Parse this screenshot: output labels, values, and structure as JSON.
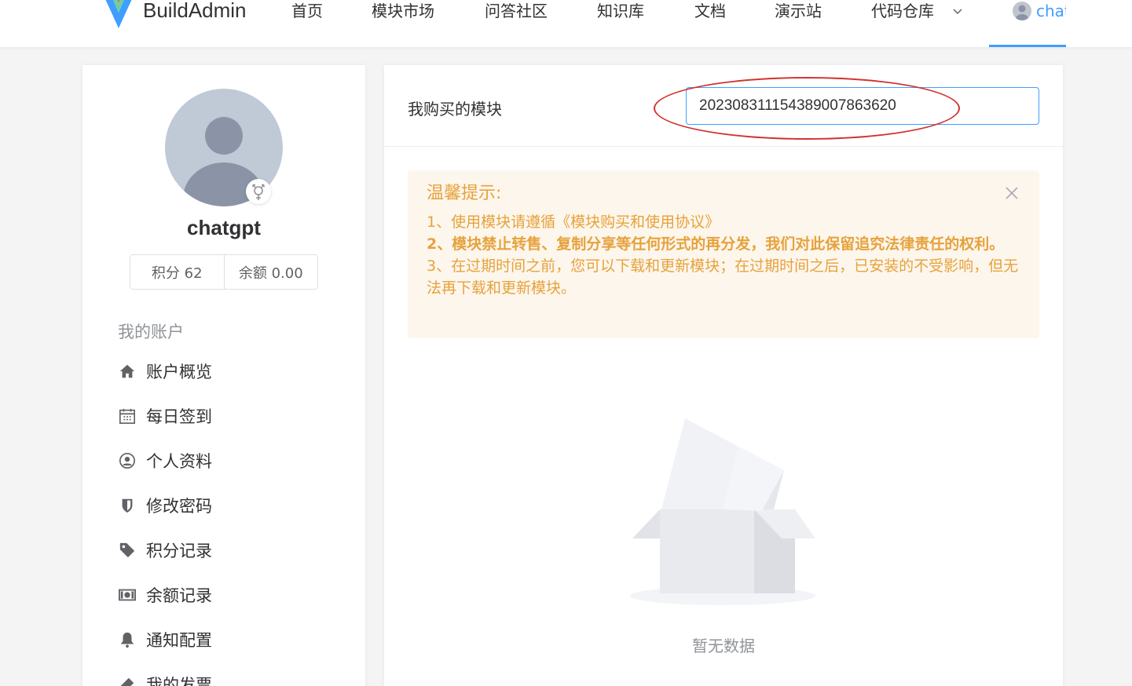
{
  "header": {
    "brand": "BuildAdmin",
    "nav": [
      {
        "label": "首页"
      },
      {
        "label": "模块市场"
      },
      {
        "label": "问答社区"
      },
      {
        "label": "知识库"
      },
      {
        "label": "文档"
      },
      {
        "label": "演示站"
      },
      {
        "label": "代码仓库"
      }
    ],
    "user_name": "chatgpt"
  },
  "sidebar": {
    "username": "chatgpt",
    "points_label": "积分 62",
    "balance_label": "余额 0.00",
    "section_title": "我的账户",
    "menu": [
      {
        "label": "账户概览",
        "icon": "home-icon"
      },
      {
        "label": "每日签到",
        "icon": "calendar-icon"
      },
      {
        "label": "个人资料",
        "icon": "user-circle-icon"
      },
      {
        "label": "修改密码",
        "icon": "shield-icon"
      },
      {
        "label": "积分记录",
        "icon": "tag-icon"
      },
      {
        "label": "余额记录",
        "icon": "money-icon"
      },
      {
        "label": "通知配置",
        "icon": "bell-icon"
      },
      {
        "label": "我的发票",
        "icon": "ticket-icon"
      }
    ]
  },
  "main": {
    "title": "我购买的模块",
    "search_value": "20230831115438900786362​0",
    "alert": {
      "title": "温馨提示:",
      "line1": "1、使用模块请遵循《模块购买和使用协议》",
      "line2": "2、模块禁止转售、复制分享等任何形式的再分发，我们对此保留追究法律责任的权利。",
      "line3": "3、在过期时间之前，您可以下载和更新模块；在过期时间之后，已安装的不受影响，但无法再下载和更新模块。"
    },
    "empty_text": "暂无数据"
  },
  "colors": {
    "primary": "#409eff",
    "warning": "#e6a23c",
    "warning_bg": "#fdf6ec",
    "annotation": "#d0312d"
  }
}
